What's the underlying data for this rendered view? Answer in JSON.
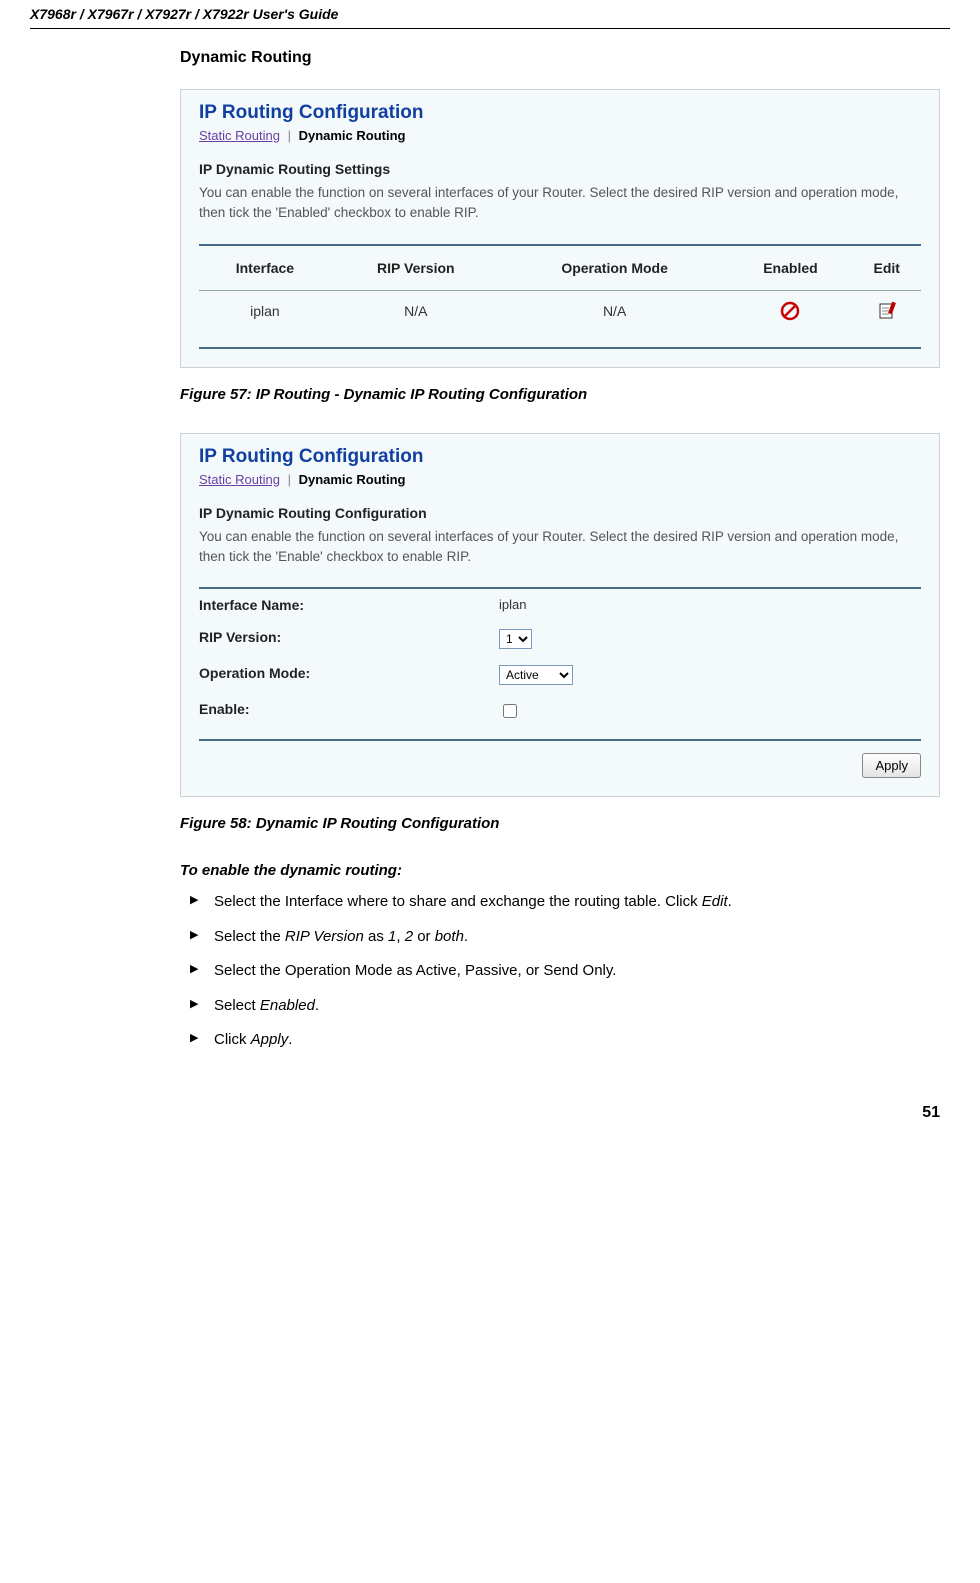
{
  "header": "X7968r / X7967r / X7927r / X7922r User's Guide",
  "section_title": "Dynamic Routing",
  "shot1": {
    "panel_title": "IP Routing Configuration",
    "tab_inactive": "Static Routing",
    "tab_active": "Dynamic Routing",
    "sub_heading": "IP Dynamic Routing Settings",
    "desc": "You can enable the function on several interfaces of your Router. Select the desired RIP version and operation mode, then tick the 'Enabled' checkbox to enable RIP.",
    "cols": {
      "c1": "Interface",
      "c2": "RIP Version",
      "c3": "Operation Mode",
      "c4": "Enabled",
      "c5": "Edit"
    },
    "row": {
      "c1": "iplan",
      "c2": "N/A",
      "c3": "N/A"
    }
  },
  "caption1": "Figure 57: IP Routing - Dynamic IP Routing Configuration",
  "shot2": {
    "panel_title": "IP Routing Configuration",
    "tab_inactive": "Static Routing",
    "tab_active": "Dynamic Routing",
    "sub_heading": "IP Dynamic Routing Configuration",
    "desc": "You can enable the function on several interfaces of your Router. Select the desired RIP version and operation mode, then tick the 'Enable' checkbox to enable RIP.",
    "labels": {
      "iface": "Interface Name:",
      "rip": "RIP Version:",
      "op": "Operation Mode:",
      "en": "Enable:"
    },
    "vals": {
      "iface": "iplan",
      "rip": "1",
      "op": "Active"
    },
    "apply": "Apply"
  },
  "caption2": "Figure 58: Dynamic IP Routing Configuration",
  "instr_head": "To enable the dynamic routing:",
  "instr": {
    "i1a": "Select the Interface where to share and exchange the routing table. Click ",
    "i1b": "Edit",
    "i1c": ".",
    "i2a": "Select the ",
    "i2b": "RIP Version",
    "i2c": " as ",
    "i2d": "1",
    "i2e": ", ",
    "i2f": "2",
    "i2g": " or ",
    "i2h": "both",
    "i2i": ".",
    "i3": "Select the Operation Mode as Active, Passive, or Send Only.",
    "i4a": "Select ",
    "i4b": "Enabled",
    "i4c": ".",
    "i5a": "Click ",
    "i5b": "Apply",
    "i5c": "."
  },
  "page_num": "51"
}
